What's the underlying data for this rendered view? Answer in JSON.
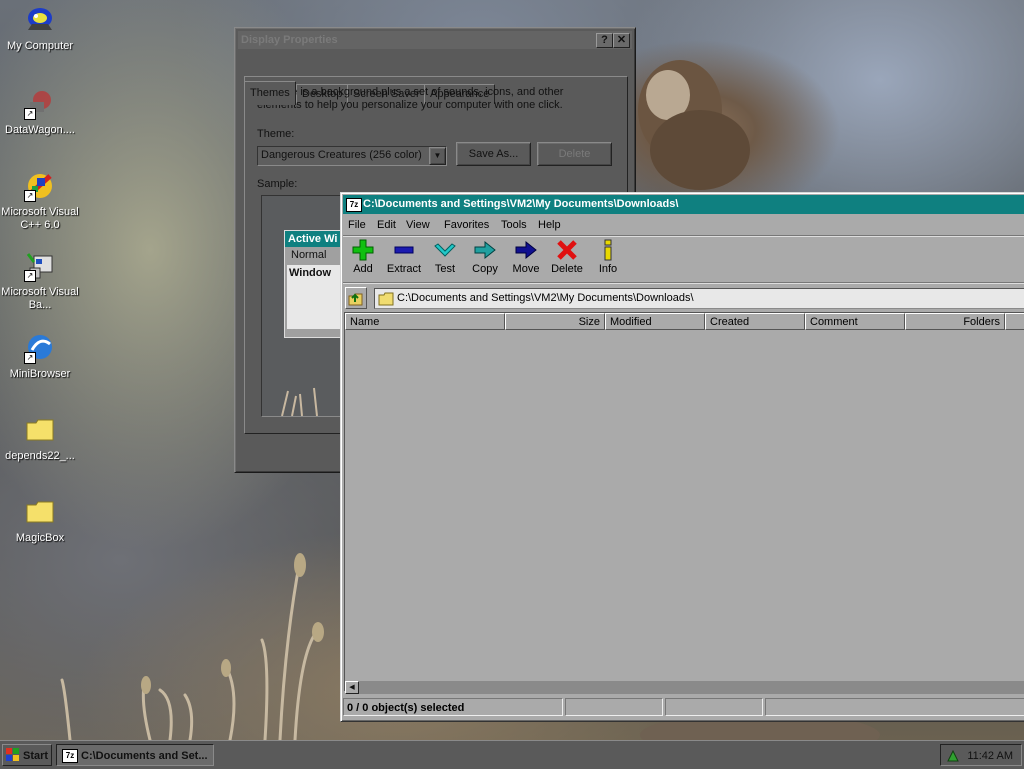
{
  "desktop": {
    "icons": [
      {
        "label": "My Computer",
        "icon": "my-computer-icon"
      },
      {
        "label": "DataWagon....",
        "icon": "datawagon-icon"
      },
      {
        "label": "Microsoft Visual C++ 6.0",
        "icon": "visual-cpp-icon"
      },
      {
        "label": "Microsoft Visual Ba...",
        "icon": "visual-basic-icon"
      },
      {
        "label": "MiniBrowser",
        "icon": "minibrowser-icon"
      },
      {
        "label": "depends22_...",
        "icon": "folder-icon"
      },
      {
        "label": "MagicBox",
        "icon": "folder-icon"
      }
    ]
  },
  "display_properties": {
    "title": "Display Properties",
    "help_button": "?",
    "close_button": "✕",
    "tabs": [
      "Themes",
      "Desktop",
      "Screen Saver",
      "Appearance"
    ],
    "active_tab": "Themes",
    "description": "A theme is a background plus a set of sounds, icons, and other elements to help you personalize your computer with one click.",
    "theme_label": "Theme:",
    "theme_value": "Dangerous Creatures (256 color)",
    "save_as_label": "Save As...",
    "delete_label": "Delete",
    "sample_label": "Sample:",
    "preview": {
      "active_window_title": "Active Wi",
      "normal_label": "Normal",
      "window_text": "Window"
    }
  },
  "file_manager": {
    "title": "C:\\Documents and Settings\\VM2\\My Documents\\Downloads\\",
    "app_icon": "7z",
    "menu": [
      "File",
      "Edit",
      "View",
      "Favorites",
      "Tools",
      "Help"
    ],
    "toolbar": [
      {
        "label": "Add",
        "icon": "add-plus-icon",
        "color": "#00c000"
      },
      {
        "label": "Extract",
        "icon": "extract-minus-icon",
        "color": "#1010a0"
      },
      {
        "label": "Test",
        "icon": "test-check-icon",
        "color": "#00a0a0"
      },
      {
        "label": "Copy",
        "icon": "copy-arrow-icon",
        "color": "#008080"
      },
      {
        "label": "Move",
        "icon": "move-arrow-icon",
        "color": "#000080"
      },
      {
        "label": "Delete",
        "icon": "delete-x-icon",
        "color": "#e00000"
      },
      {
        "label": "Info",
        "icon": "info-icon",
        "color": "#d0c000"
      }
    ],
    "address": "C:\\Documents and Settings\\VM2\\My Documents\\Downloads\\",
    "columns": [
      "Name",
      "Size",
      "Modified",
      "Created",
      "Comment",
      "Folders"
    ],
    "status": "0 / 0 object(s) selected"
  },
  "taskbar": {
    "start_label": "Start",
    "task_label": "C:\\Documents and Set...",
    "clock": "11:42 AM"
  },
  "colors": {
    "titlebar_active": "#0f8080",
    "window_bg": "#aaaaaa",
    "inactive_chrome": "#5a5a5a"
  }
}
